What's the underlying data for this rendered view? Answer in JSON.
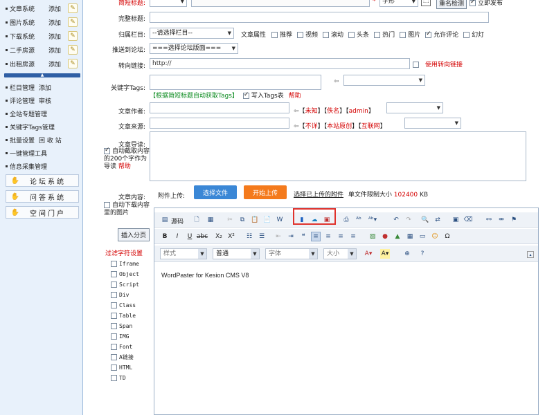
{
  "sidebar": {
    "modules": [
      {
        "label": "文章系统",
        "add": "添加"
      },
      {
        "label": "图片系统",
        "add": "添加"
      },
      {
        "label": "下载系统",
        "add": "添加"
      },
      {
        "label": "二手房源",
        "add": "添加"
      },
      {
        "label": "出租房源",
        "add": "添加"
      }
    ],
    "links": [
      {
        "a": "栏目管理",
        "b": "添加"
      },
      {
        "a": "评论管理",
        "b": "审核"
      },
      {
        "a": "全站专题管理",
        "b": ""
      },
      {
        "a": "关键字Tags管理",
        "b": ""
      },
      {
        "a": "批量设置",
        "b": "回 收 站"
      },
      {
        "a": "一键管理工具",
        "b": ""
      },
      {
        "a": "信息采集管理",
        "b": ""
      }
    ],
    "boxes": [
      "论坛系统",
      "问答系统",
      "空间门户"
    ]
  },
  "form": {
    "simple_title_label": "简短标题:",
    "style_select": "字形",
    "rename_check": "重名检测",
    "publish_now": "立即发布",
    "full_title_label": "完整标题:",
    "column_label": "归属栏目:",
    "column_select": "--请选择栏目--",
    "attr_label": "文章属性",
    "attrs": [
      {
        "t": "推荐",
        "on": false
      },
      {
        "t": "视频",
        "on": false
      },
      {
        "t": "滚动",
        "on": false
      },
      {
        "t": "头条",
        "on": false
      },
      {
        "t": "热门",
        "on": false
      },
      {
        "t": "图片",
        "on": false
      },
      {
        "t": "允许评论",
        "on": true
      },
      {
        "t": "幻灯",
        "on": false
      }
    ],
    "forum_label": "推送到论坛:",
    "forum_select": "===选择论坛版面===",
    "redirect_label": "转向链接:",
    "redirect_value": "http://",
    "redirect_check": "使用转向链接",
    "tags_label": "关键字Tags:",
    "tags_hint": "【根据简短标题自动获取Tags】",
    "tags_write": "写入Tags表",
    "tags_help": "帮助",
    "author_label": "文章作者:",
    "author_links": [
      "未知",
      "佚名",
      "admin"
    ],
    "source_label": "文章来源:",
    "source_links": [
      "不详",
      "本站原创",
      "互联网"
    ],
    "intro_label": "文章导读:",
    "intro_auto": "自动截取内容的200个字作为导读",
    "intro_help": "帮助",
    "content_label": "文章内容:",
    "content_auto": "自动下载内容里的图片",
    "insert_page": "插入分页",
    "filter_title": "过滤字符设置",
    "filters": [
      "Iframe",
      "Object",
      "Script",
      "Div",
      "Class",
      "Table",
      "Span",
      "IMG",
      "Font",
      "A链接",
      "HTML",
      "TD"
    ],
    "attach_label": "附件上传:",
    "select_file": "选择文件",
    "start_upload": "开始上传",
    "select_uploaded": "选择已上传的附件",
    "size_limit_prefix": "单文件限制大小",
    "size_limit_value": "102400",
    "size_limit_unit": "KB"
  },
  "editor": {
    "source": "源码",
    "style_combo": "样式",
    "format_combo": "普通",
    "font_combo": "字体",
    "size_combo": "大小",
    "content": "WordPaster for Kesion CMS V8"
  }
}
